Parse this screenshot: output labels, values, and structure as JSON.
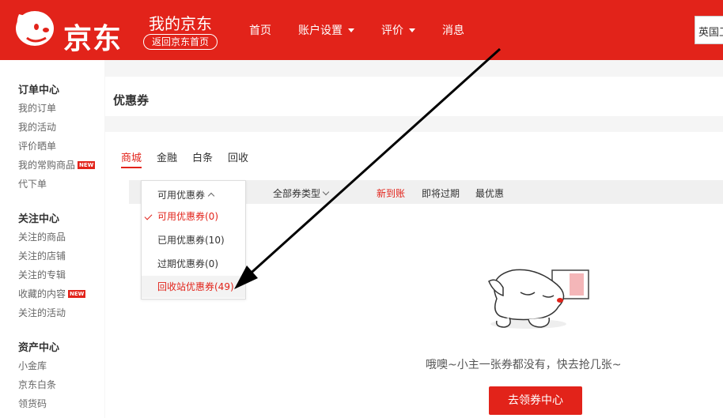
{
  "header": {
    "logo_text": "京东",
    "title": "我的京东",
    "back_home": "返回京东首页",
    "nav": [
      {
        "label": "首页",
        "has_dropdown": false
      },
      {
        "label": "账户设置",
        "has_dropdown": true
      },
      {
        "label": "评价",
        "has_dropdown": true
      },
      {
        "label": "消息",
        "has_dropdown": false
      }
    ],
    "search_value": "英国卫"
  },
  "sidebar": {
    "groups": [
      {
        "title": "订单中心",
        "items": [
          {
            "label": "我的订单"
          },
          {
            "label": "我的活动"
          },
          {
            "label": "评价晒单"
          },
          {
            "label": "我的常购商品",
            "badge": "NEW"
          },
          {
            "label": "代下单"
          }
        ]
      },
      {
        "title": "关注中心",
        "items": [
          {
            "label": "关注的商品"
          },
          {
            "label": "关注的店铺"
          },
          {
            "label": "关注的专辑"
          },
          {
            "label": "收藏的内容",
            "badge": "NEW"
          },
          {
            "label": "关注的活动"
          }
        ]
      },
      {
        "title": "资产中心",
        "items": [
          {
            "label": "小金库"
          },
          {
            "label": "京东白条"
          },
          {
            "label": "领货码"
          }
        ]
      }
    ]
  },
  "main": {
    "title": "优惠券",
    "tabs": [
      "商城",
      "金融",
      "白条",
      "回收"
    ],
    "active_tab": "商城",
    "filter": {
      "status_label": "可用优惠券",
      "type_label": "全部券类型",
      "sorts": [
        "新到账",
        "即将过期",
        "最优惠"
      ],
      "active_sort": "新到账"
    },
    "dropdown": {
      "header": "可用优惠券",
      "items": [
        "可用优惠券(0)",
        "已用优惠券(10)",
        "过期优惠券(0)",
        "回收站优惠券(49)"
      ],
      "selected": "可用优惠券(0)",
      "highlighted": "回收站优惠券(49)"
    },
    "empty_message": "哦噢~小主一张券都没有，快去抢几张~",
    "cta_button": "去领券中心"
  },
  "colors": {
    "brand_red": "#e2231a",
    "arrow": "#000000"
  }
}
